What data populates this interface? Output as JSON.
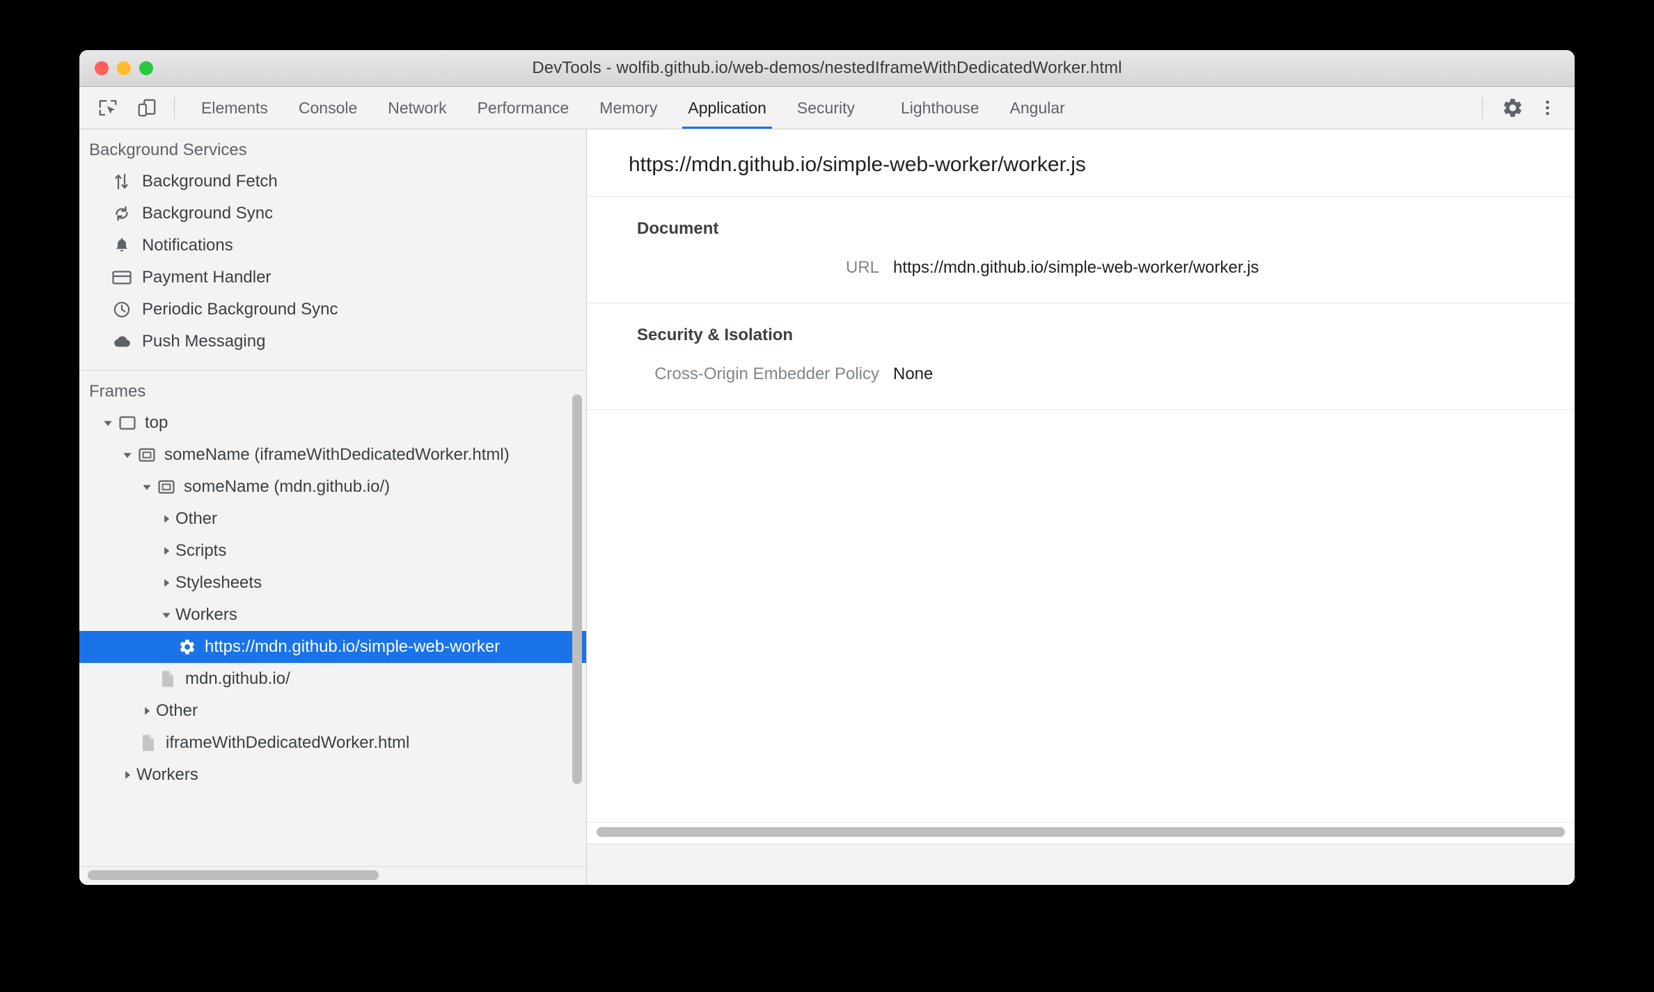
{
  "window": {
    "title": "DevTools - wolfib.github.io/web-demos/nestedIframeWithDedicatedWorker.html",
    "traffic_lights": [
      "close-button",
      "minimize-button",
      "zoom-button"
    ]
  },
  "toolbar": {
    "inspect_icon": "inspect-element-icon",
    "device_icon": "device-toolbar-icon",
    "settings_icon": "gear-icon",
    "more_icon": "more-options-icon",
    "tabs": [
      {
        "label": "Elements",
        "active": false
      },
      {
        "label": "Console",
        "active": false
      },
      {
        "label": "Network",
        "active": false
      },
      {
        "label": "Performance",
        "active": false
      },
      {
        "label": "Memory",
        "active": false
      },
      {
        "label": "Application",
        "active": true
      },
      {
        "label": "Security",
        "active": false
      },
      {
        "label": "Lighthouse",
        "active": false
      },
      {
        "label": "Angular",
        "active": false
      }
    ],
    "active_tab_accent": "#1a73e8"
  },
  "sidebar": {
    "background_services": {
      "heading": "Background Services",
      "items": [
        {
          "label": "Background Fetch",
          "icon": "transfer-arrows-icon"
        },
        {
          "label": "Background Sync",
          "icon": "sync-icon"
        },
        {
          "label": "Notifications",
          "icon": "bell-icon"
        },
        {
          "label": "Payment Handler",
          "icon": "credit-card-icon"
        },
        {
          "label": "Periodic Background Sync",
          "icon": "clock-icon"
        },
        {
          "label": "Push Messaging",
          "icon": "cloud-icon"
        }
      ]
    },
    "frames": {
      "heading": "Frames",
      "tree": [
        {
          "label": "top",
          "icon": "frame-icon",
          "twisty": "expanded",
          "indent": 1,
          "selected": false
        },
        {
          "label": "someName (iframeWithDedicatedWorker.html)",
          "icon": "iframe-icon",
          "twisty": "expanded",
          "indent": 2,
          "selected": false
        },
        {
          "label": "someName (mdn.github.io/)",
          "icon": "iframe-icon",
          "twisty": "expanded",
          "indent": 3,
          "selected": false
        },
        {
          "label": "Other",
          "icon": "none",
          "twisty": "collapsed",
          "indent": 4,
          "selected": false
        },
        {
          "label": "Scripts",
          "icon": "none",
          "twisty": "collapsed",
          "indent": 4,
          "selected": false
        },
        {
          "label": "Stylesheets",
          "icon": "none",
          "twisty": "collapsed",
          "indent": 4,
          "selected": false
        },
        {
          "label": "Workers",
          "icon": "none",
          "twisty": "expanded",
          "indent": 4,
          "selected": false
        },
        {
          "label": "https://mdn.github.io/simple-web-worker",
          "icon": "worker-gear-icon",
          "twisty": "none",
          "indent": 5,
          "selected": true
        },
        {
          "label": "mdn.github.io/",
          "icon": "document-icon",
          "twisty": "none",
          "indent": 4,
          "selected": false
        },
        {
          "label": "Other",
          "icon": "none",
          "twisty": "collapsed",
          "indent": 3,
          "selected": false
        },
        {
          "label": "iframeWithDedicatedWorker.html",
          "icon": "document-icon",
          "twisty": "none",
          "indent": 3,
          "selected": false
        },
        {
          "label": "Workers",
          "icon": "none",
          "twisty": "collapsed",
          "indent": 2,
          "selected": false
        }
      ],
      "selection_color": "#1a73e8"
    }
  },
  "details": {
    "title": "https://mdn.github.io/simple-web-worker/worker.js",
    "sections": [
      {
        "heading": "Document",
        "rows": [
          {
            "key": "URL",
            "value": "https://mdn.github.io/simple-web-worker/worker.js"
          }
        ]
      },
      {
        "heading": "Security & Isolation",
        "rows": [
          {
            "key": "Cross-Origin Embedder Policy",
            "value": "None"
          }
        ]
      }
    ]
  },
  "scrollbars": {
    "left_vertical": "left-pane-vertical-scrollbar",
    "left_horizontal": "left-pane-horizontal-scrollbar",
    "right_horizontal": "right-pane-horizontal-scrollbar"
  }
}
